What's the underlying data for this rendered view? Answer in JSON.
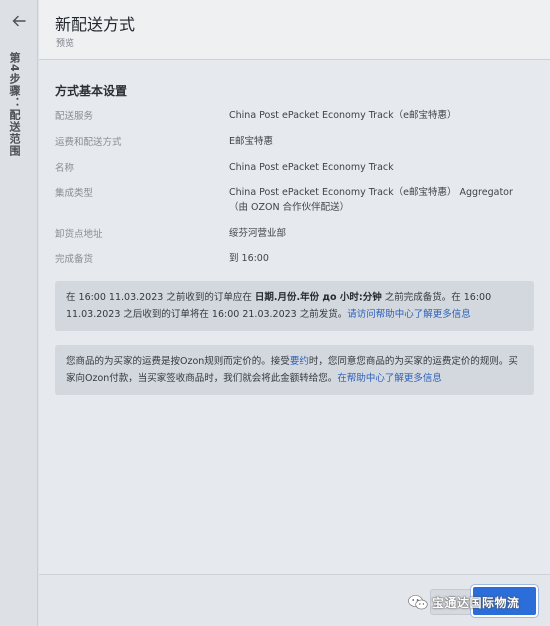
{
  "rail": {
    "back_icon": "arrow-left-icon",
    "step_label": "第4步骤：配送范围"
  },
  "header": {
    "title": "新配送方式",
    "subtitle": "预览"
  },
  "section": {
    "title": "方式基本设置"
  },
  "details": [
    {
      "label": "配送服务",
      "value": "China Post ePacket Economy Track（e邮宝特惠）"
    },
    {
      "label": "运费和配送方式",
      "value": "E邮宝特惠"
    },
    {
      "label": "名称",
      "value": "China Post ePacket Economy Track"
    },
    {
      "label": "集成类型",
      "value": "China Post ePacket Economy Track（e邮宝特惠） Aggregator（由 OZON 合作伙伴配送）"
    },
    {
      "label": "卸货点地址",
      "value": "绥芬河营业部"
    },
    {
      "label": "完成备货",
      "value": "到 16:00"
    }
  ],
  "notice1": {
    "part1": "在 16:00 11.03.2023 之前收到的订单应在 ",
    "bold": "日期.月份.年份 до 小时:分钟",
    "part2": " 之前完成备货。在 16:00 11.03.2023 之后收到的订单将在 16:00 21.03.2023 之前发货。",
    "link": "请访问帮助中心了解更多信息"
  },
  "notice2": {
    "part1": "您商品的为买家的运费是按Ozon规则而定价的。接受",
    "link1": "要约",
    "part2": "时，您同意您商品的为买家的运费定价的规则。买家向Ozon付款，当买家签收商品时，我们就会将此金额转给您。",
    "link2": "在帮助中心了解更多信息"
  },
  "watermark": {
    "text": "宝通达国际物流",
    "icon": "wechat-icon"
  },
  "colors": {
    "primary": "#2b6dd9",
    "link": "#2e61b8",
    "notice_bg": "#d3d8df"
  }
}
